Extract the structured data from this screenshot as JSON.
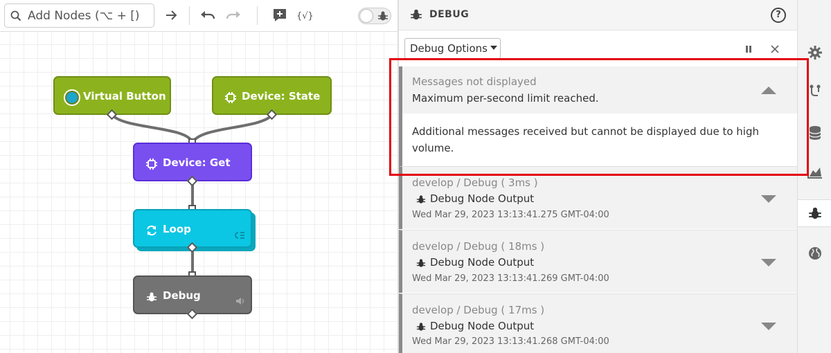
{
  "toolbar": {
    "search_label": "Add Nodes (⌥ + [)",
    "icons": [
      "search-icon",
      "arrow-right-icon",
      "undo-icon",
      "redo-icon",
      "add-comment-icon",
      "variables-icon",
      "debug-toggle"
    ]
  },
  "canvas": {
    "nodes": [
      {
        "label": "Virtual Button",
        "color": "#8cb31e"
      },
      {
        "label": "Device: State",
        "color": "#8cb31e"
      },
      {
        "label": "Device: Get",
        "color": "#7a4ff0"
      },
      {
        "label": "Loop",
        "color": "#0bc7e3"
      },
      {
        "label": "Debug",
        "color": "#737373"
      }
    ]
  },
  "debug_panel": {
    "title": "DEBUG",
    "options_label": "Debug Options",
    "help_label": "?",
    "warning": {
      "subtitle": "Messages not displayed",
      "headline": "Maximum per-second limit reached.",
      "body": "Additional messages received but cannot be displayed due to high volume."
    },
    "messages": [
      {
        "source": "develop / Debug ( 3ms )",
        "title": "Debug Node Output",
        "timestamp": "Wed Mar 29, 2023 13:13:41.275 GMT-04:00"
      },
      {
        "source": "develop / Debug ( 18ms )",
        "title": "Debug Node Output",
        "timestamp": "Wed Mar 29, 2023 13:13:41.269 GMT-04:00"
      },
      {
        "source": "develop / Debug ( 17ms )",
        "title": "Debug Node Output",
        "timestamp": "Wed Mar 29, 2023 13:13:41.268 GMT-04:00"
      }
    ]
  },
  "sidebar": {
    "items": [
      "gear-icon",
      "flow-icon",
      "database-icon",
      "chart-icon",
      "bug-icon",
      "globe-icon"
    ],
    "active": "bug-icon"
  },
  "colors": {
    "highlight": "#e3000f",
    "accent_green": "#8cb31e",
    "accent_purple": "#7a4ff0",
    "accent_cyan": "#0bc7e3"
  }
}
